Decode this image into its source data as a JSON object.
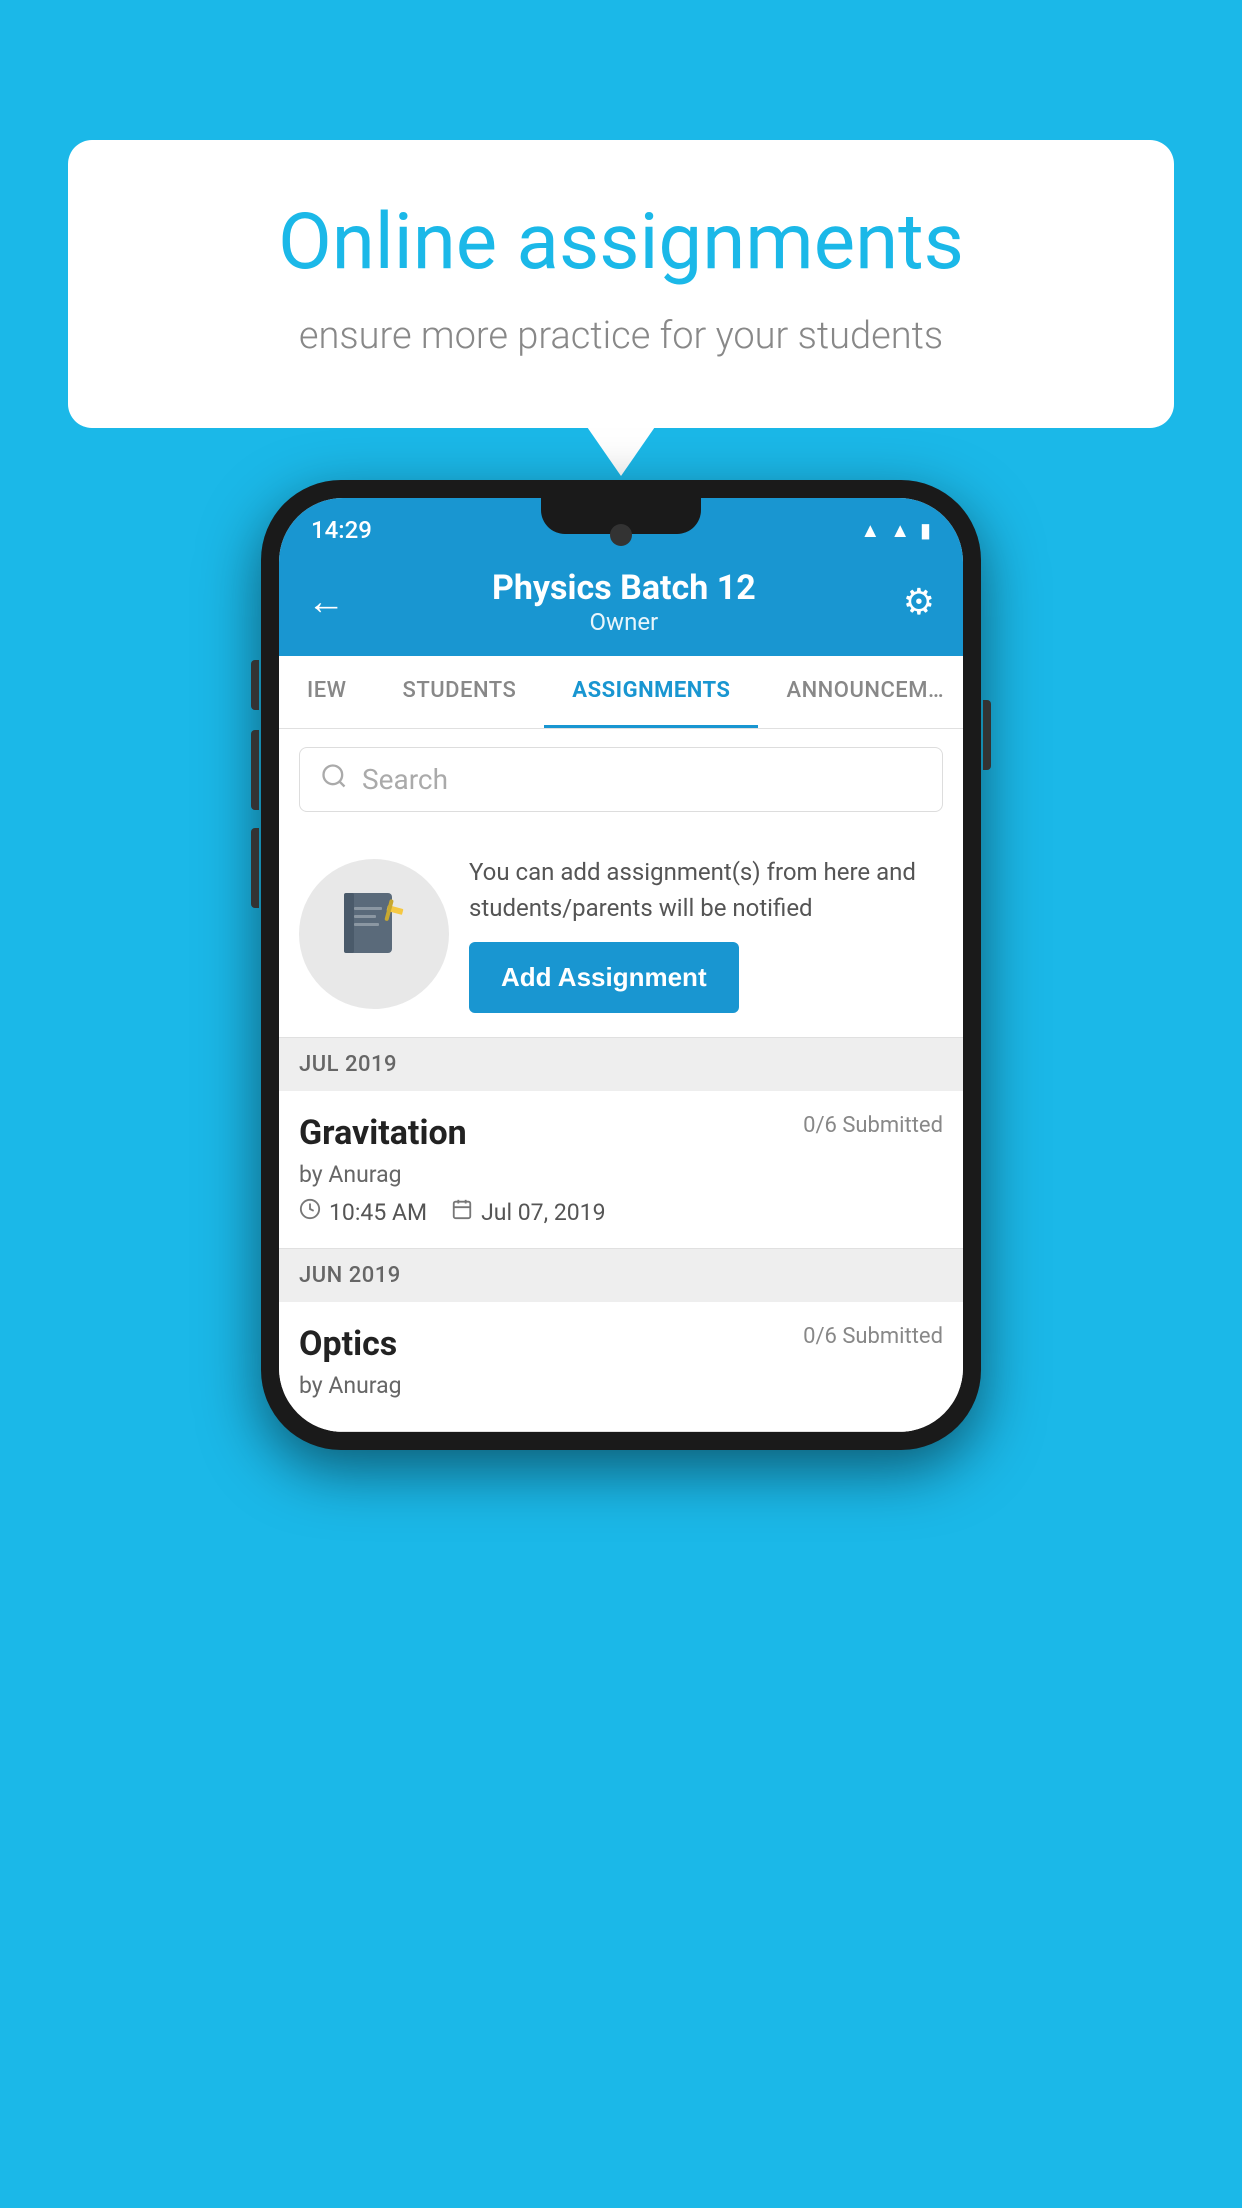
{
  "background": {
    "color": "#1BB8E8"
  },
  "speech_bubble": {
    "title": "Online assignments",
    "subtitle": "ensure more practice for your students"
  },
  "phone": {
    "status_bar": {
      "time": "14:29",
      "wifi_icon": "wifi",
      "signal_icon": "signal",
      "battery_icon": "battery"
    },
    "header": {
      "back_label": "←",
      "title": "Physics Batch 12",
      "subtitle": "Owner",
      "gear_label": "⚙"
    },
    "tabs": [
      {
        "label": "IEW",
        "active": false
      },
      {
        "label": "STUDENTS",
        "active": false
      },
      {
        "label": "ASSIGNMENTS",
        "active": true
      },
      {
        "label": "ANNOUNCEMENTS",
        "active": false
      }
    ],
    "search": {
      "placeholder": "Search"
    },
    "promo_card": {
      "description": "You can add assignment(s) from here and students/parents will be notified",
      "button_label": "Add Assignment"
    },
    "sections": [
      {
        "month": "JUL 2019",
        "assignments": [
          {
            "name": "Gravitation",
            "submitted": "0/6 Submitted",
            "author": "by Anurag",
            "time": "10:45 AM",
            "date": "Jul 07, 2019"
          }
        ]
      },
      {
        "month": "JUN 2019",
        "assignments": [
          {
            "name": "Optics",
            "submitted": "0/6 Submitted",
            "author": "by Anurag",
            "time": "",
            "date": ""
          }
        ]
      }
    ]
  }
}
